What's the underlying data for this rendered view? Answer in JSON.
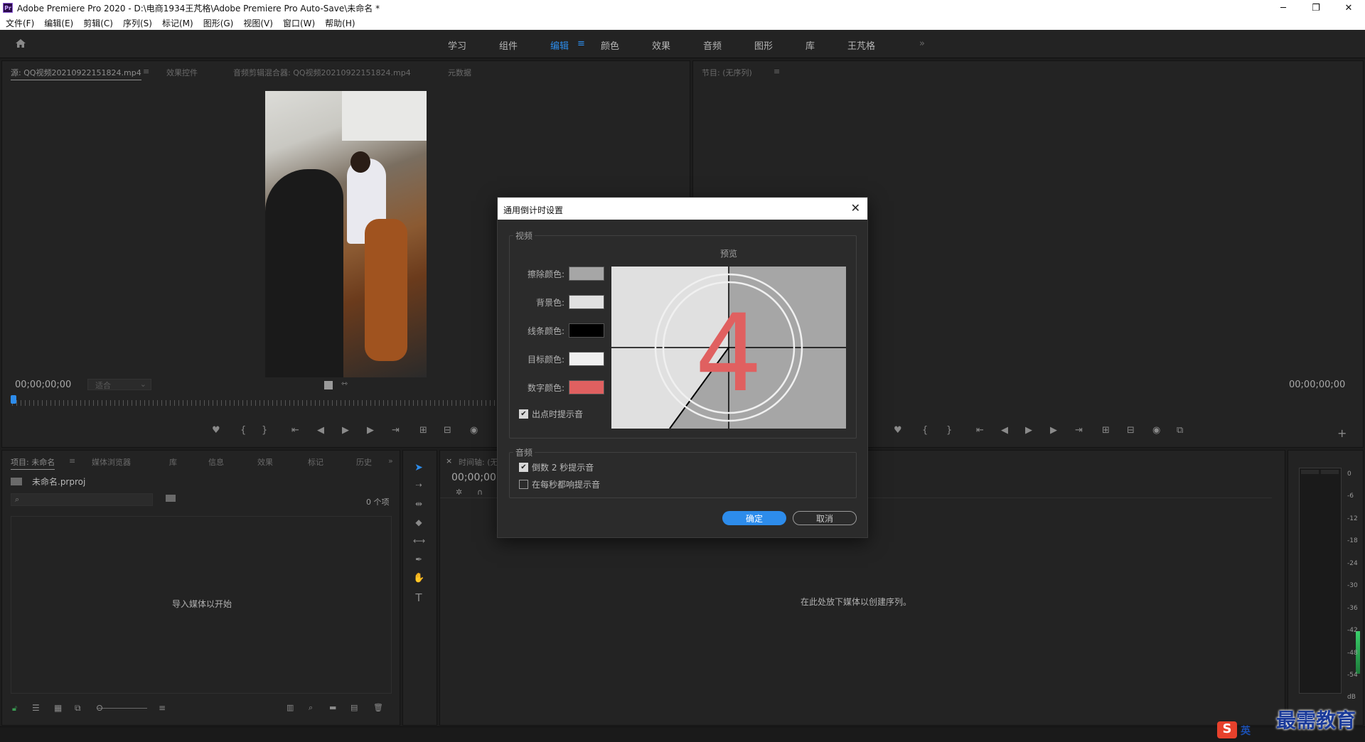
{
  "window": {
    "title": "Adobe Premiere Pro 2020 - D:\\电商1934王芃格\\Adobe Premiere Pro Auto-Save\\未命名 *",
    "logo": "Pr",
    "minimize": "─",
    "restore": "❐",
    "close": "✕"
  },
  "menu": [
    "文件(F)",
    "编辑(E)",
    "剪辑(C)",
    "序列(S)",
    "标记(M)",
    "图形(G)",
    "视图(V)",
    "窗口(W)",
    "帮助(H)"
  ],
  "workspaces": {
    "tabs": [
      "学习",
      "组件",
      "编辑",
      "颜色",
      "效果",
      "音频",
      "图形",
      "库",
      "王芃格"
    ],
    "active": "编辑",
    "overflow": "»",
    "menu_glyph": "≡"
  },
  "source_panel": {
    "tabs": [
      "源: QQ视频20210922151824.mp4",
      "效果控件",
      "音频剪辑混合器: QQ视频20210922151824.mp4",
      "元数据"
    ],
    "menu_glyph": "≡",
    "timecode": "00;00;00;00",
    "fit_select": "适合"
  },
  "program_panel": {
    "tab": "节目: (无序列)",
    "menu_glyph": "≡",
    "timecode": "00;00;00;00",
    "add_button": "+"
  },
  "project_panel": {
    "tabs": [
      "项目: 未命名",
      "媒体浏览器",
      "库",
      "信息",
      "效果",
      "标记",
      "历史"
    ],
    "menu_glyph": "≡",
    "overflow": "»",
    "file_name": "未命名.prproj",
    "item_count": "0 个项",
    "empty_message": "导入媒体以开始"
  },
  "timeline_panel": {
    "close": "×",
    "tab": "时间轴: (无序列)",
    "timecode": "00;00;00",
    "empty_message": "在此处放下媒体以创建序列。"
  },
  "audio_meter": {
    "labels": [
      "0",
      "-6",
      "-12",
      "-18",
      "-24",
      "-30",
      "-36",
      "-42",
      "-48",
      "-54",
      "dB"
    ]
  },
  "dialog": {
    "title": "通用倒计时设置",
    "close": "✕",
    "video_group": "视频",
    "preview_label": "预览",
    "preview_number": "4",
    "colors": [
      {
        "label": "擦除颜色:",
        "value": "#a6a6a6"
      },
      {
        "label": "背景色:",
        "value": "#e0e0e0"
      },
      {
        "label": "线条颜色:",
        "value": "#000000"
      },
      {
        "label": "目标颜色:",
        "value": "#f0f0f0"
      },
      {
        "label": "数字颜色:",
        "value": "#e06060"
      }
    ],
    "cue_at_out": {
      "label": "出点时提示音",
      "checked": true
    },
    "audio_group": "音频",
    "cue_2_sec": {
      "label": "倒数 2 秒提示音",
      "checked": true
    },
    "cue_every_sec": {
      "label": "在每秒都响提示音",
      "checked": false
    },
    "ok": "确定",
    "cancel": "取消"
  },
  "watermark": "最需教育",
  "ime": {
    "logo": "S",
    "lang": "英"
  }
}
